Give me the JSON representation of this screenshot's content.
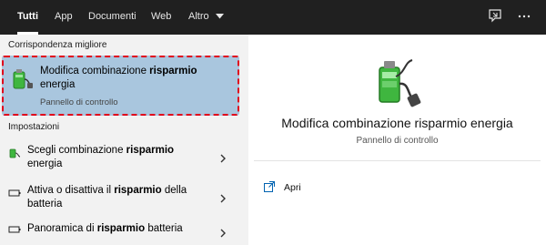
{
  "tabs": [
    {
      "label": "Tutti"
    },
    {
      "label": "App"
    },
    {
      "label": "Documenti"
    },
    {
      "label": "Web"
    },
    {
      "label": "Altro"
    }
  ],
  "top_icons": [
    "feedback-icon",
    "more-icon"
  ],
  "left": {
    "best_match_title": "Corrispondenza migliore",
    "best_match": {
      "label_prefix": "Modifica combinazione ",
      "label_bold": "risparmio",
      "label_suffix": "energia",
      "subtitle": "Pannello di controllo"
    },
    "settings_title": "Impostazioni",
    "settings": [
      {
        "prefix": "Scegli combinazione ",
        "bold": "risparmio",
        "suffix": "energia"
      },
      {
        "prefix": "Attiva o disattiva il ",
        "bold": "risparmio",
        "suffix": " della batteria"
      },
      {
        "prefix": "Panoramica di ",
        "bold": "risparmio",
        "suffix": " batteria"
      }
    ]
  },
  "right": {
    "title": "Modifica combinazione risparmio energia",
    "subtitle": "Pannello di controllo",
    "action_label": "Apri"
  },
  "colors": {
    "topbar": "#202020",
    "selection": "#a9c6de",
    "highlight_border": "#e0001b",
    "battery_green": "#3fb63f"
  }
}
